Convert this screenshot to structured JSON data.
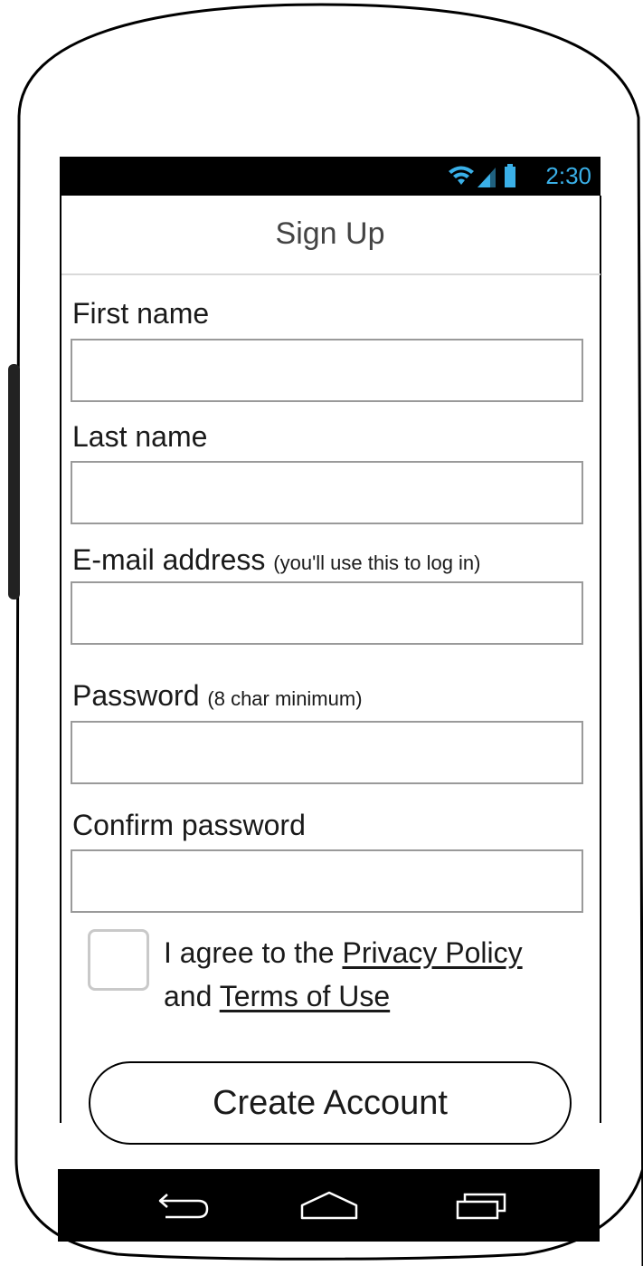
{
  "status_bar": {
    "time": "2:30",
    "icons": [
      "wifi-icon",
      "signal-icon",
      "battery-icon"
    ],
    "accent_color": "#3ab0e8"
  },
  "header": {
    "title": "Sign Up"
  },
  "form": {
    "first_name": {
      "label": "First name",
      "value": "",
      "placeholder": ""
    },
    "last_name": {
      "label": "Last name",
      "value": "",
      "placeholder": ""
    },
    "email": {
      "label": "E-mail address",
      "hint": "(you'll use this to log in)",
      "value": "",
      "placeholder": ""
    },
    "password": {
      "label": "Password",
      "hint": "(8 char minimum)",
      "value": "",
      "placeholder": ""
    },
    "confirm_password": {
      "label": "Confirm password",
      "value": "",
      "placeholder": ""
    }
  },
  "agreement": {
    "checked": false,
    "prefix": "I agree to the",
    "privacy_link": "Privacy Policy",
    "conjunction": "and",
    "terms_link": "Terms of Use"
  },
  "actions": {
    "create_account_label": "Create Account"
  },
  "nav_bar": {
    "icons": [
      "back-icon",
      "home-icon",
      "recent-apps-icon"
    ]
  }
}
